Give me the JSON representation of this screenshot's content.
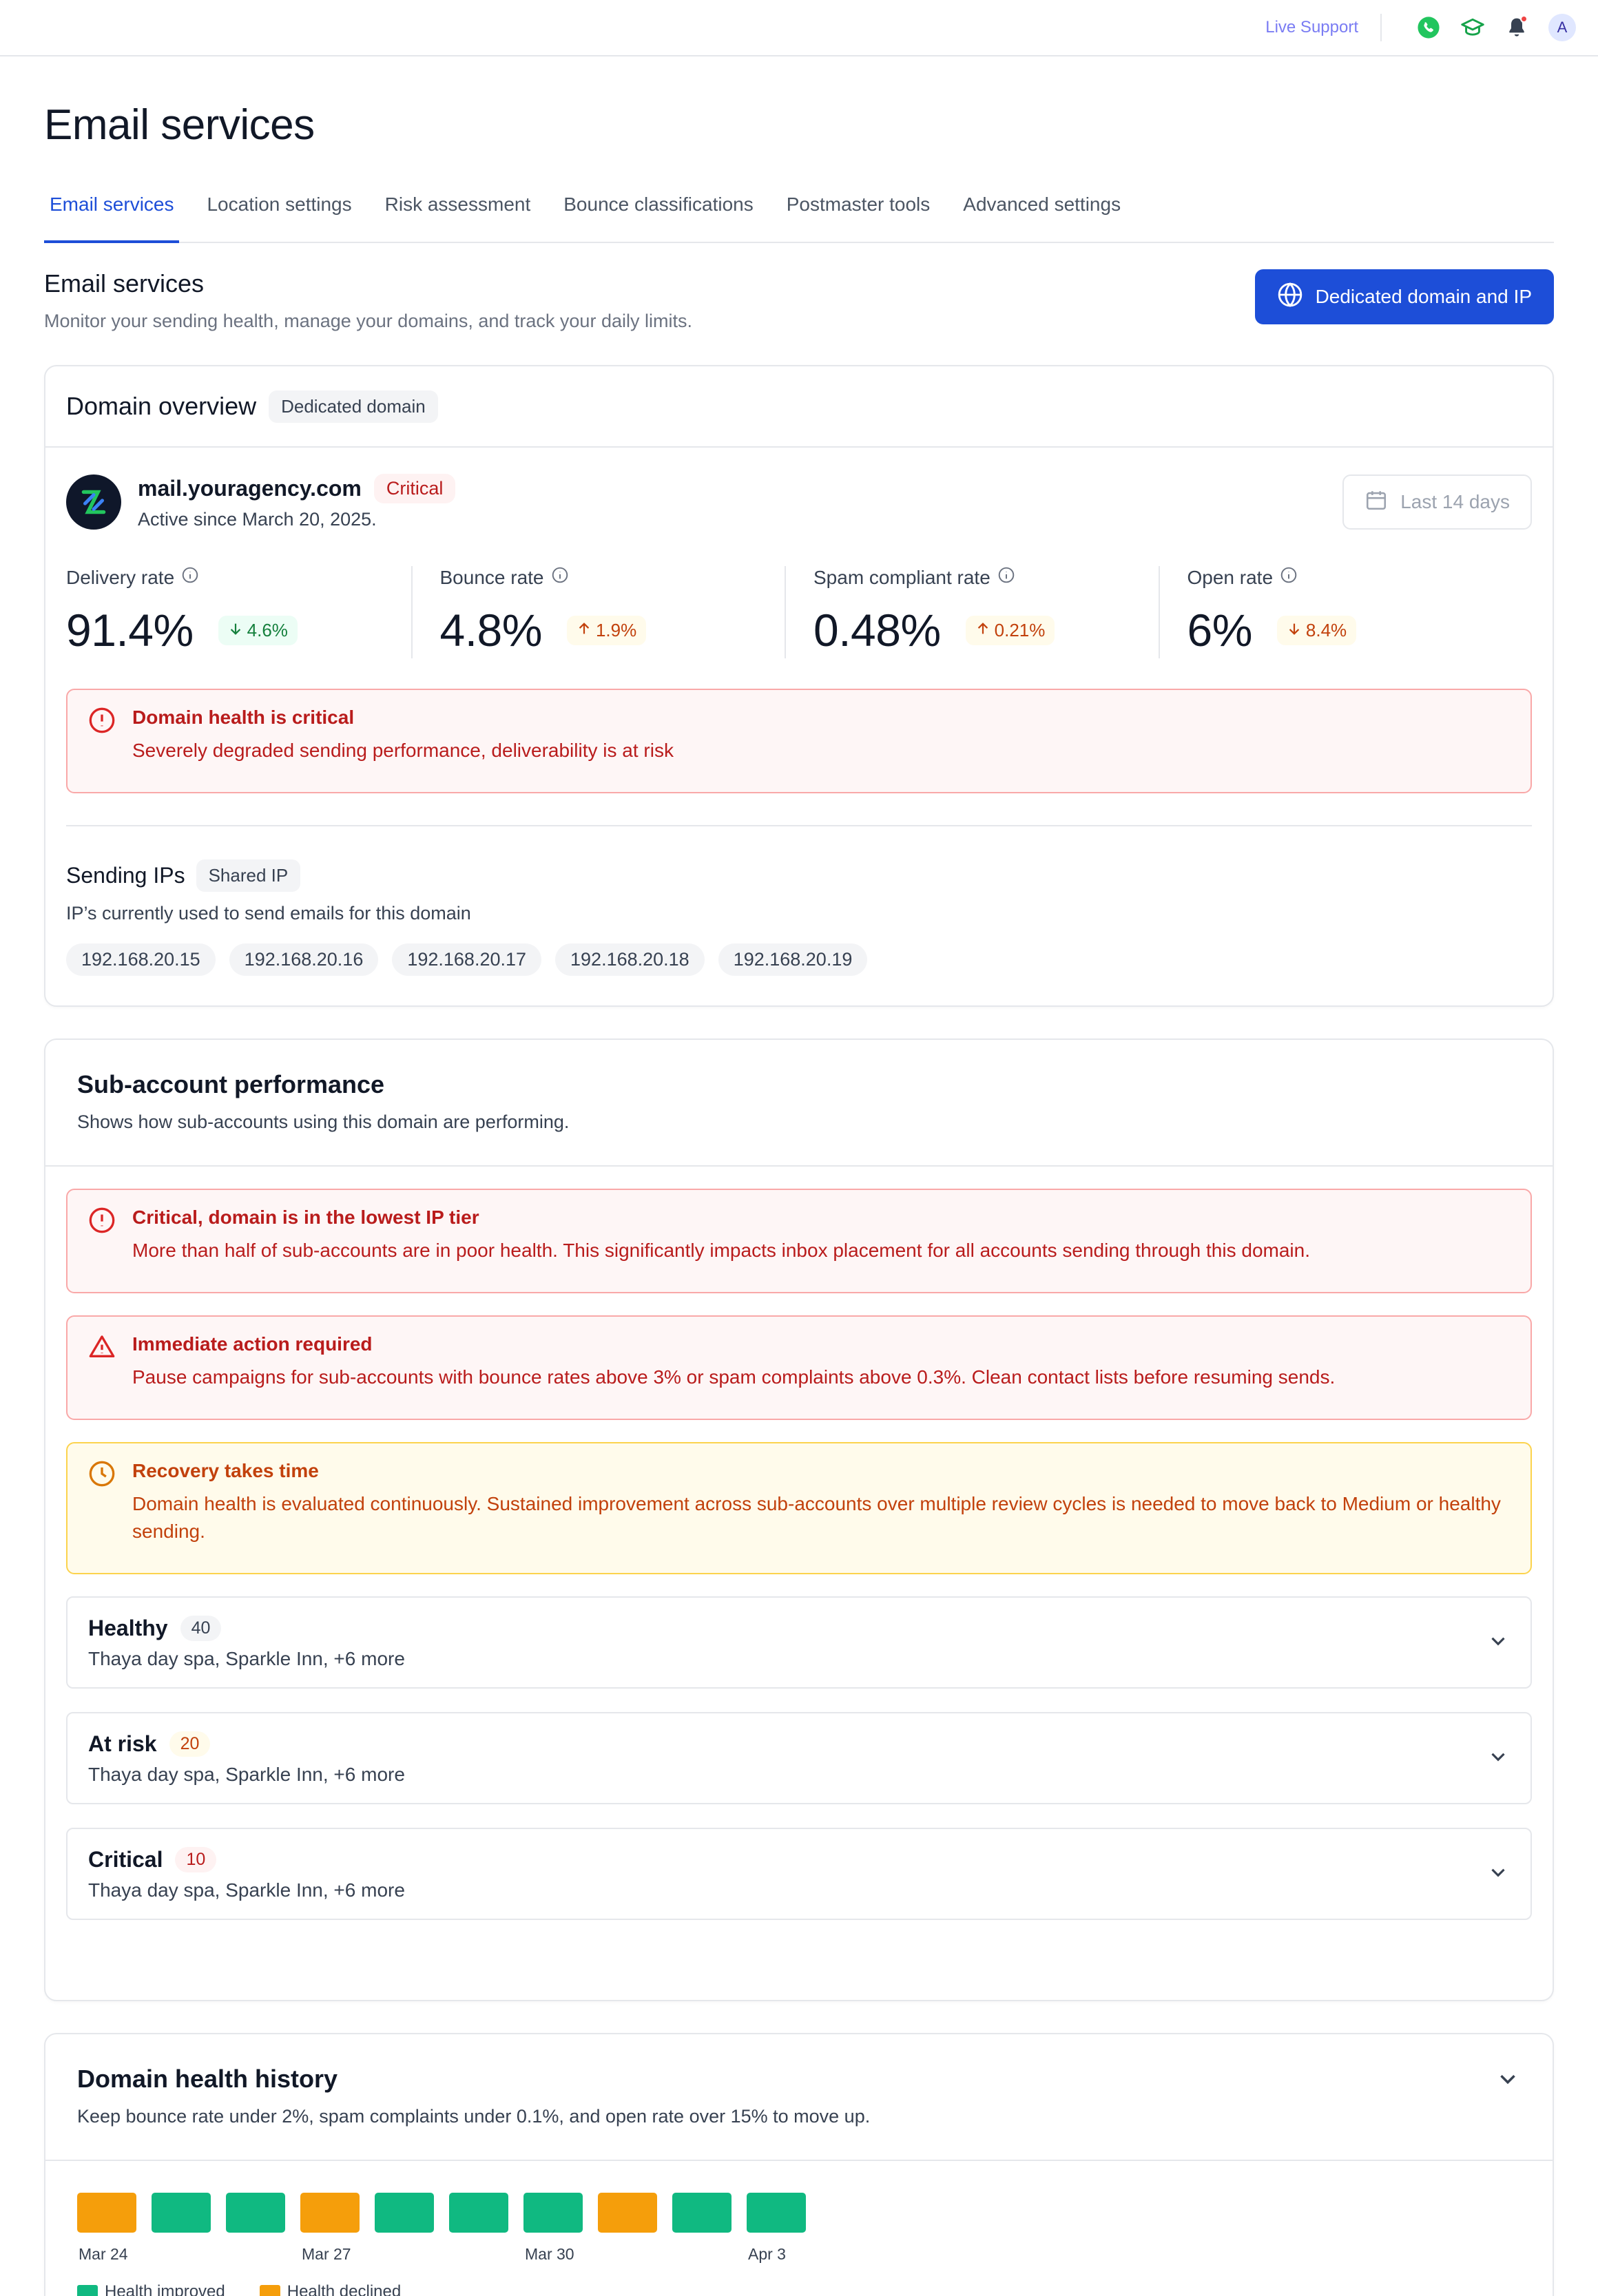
{
  "topbar": {
    "live_support": "Live Support",
    "avatar_initial": "A",
    "colors": {
      "phone": "#22c55e",
      "cap": "#16a34a",
      "bell": "#374151",
      "dot": "#ef4444"
    }
  },
  "page": {
    "title": "Email services",
    "tabs": [
      {
        "label": "Email services",
        "active": true
      },
      {
        "label": "Location settings",
        "active": false
      },
      {
        "label": "Risk assessment",
        "active": false
      },
      {
        "label": "Bounce classifications",
        "active": false
      },
      {
        "label": "Postmaster tools",
        "active": false
      },
      {
        "label": "Advanced settings",
        "active": false
      }
    ]
  },
  "section": {
    "title": "Email services",
    "description": "Monitor your sending health, manage your domains, and track your daily limits.",
    "primary_button": "Dedicated domain and IP"
  },
  "domain_overview": {
    "title": "Domain overview",
    "chip": "Dedicated domain",
    "domain": "mail.youragency.com",
    "status": "Critical",
    "active_since": "Active since March 20, 2025.",
    "date_range": "Last 14 days",
    "metrics": [
      {
        "label": "Delivery rate",
        "value": "91.4%",
        "delta": "4.6%",
        "direction": "down",
        "tone": "good"
      },
      {
        "label": "Bounce rate",
        "value": "4.8%",
        "delta": "1.9%",
        "direction": "up",
        "tone": "warn"
      },
      {
        "label": "Spam compliant rate",
        "value": "0.48%",
        "delta": "0.21%",
        "direction": "up",
        "tone": "warn"
      },
      {
        "label": "Open rate",
        "value": "6%",
        "delta": "8.4%",
        "direction": "down",
        "tone": "warn"
      }
    ],
    "alert": {
      "title": "Domain health is critical",
      "body": "Severely degraded sending performance, deliverability is at risk"
    },
    "sending_ips": {
      "title": "Sending IPs",
      "chip": "Shared IP",
      "description": "IP’s currently used to send emails for this domain",
      "ips": [
        "192.168.20.15",
        "192.168.20.16",
        "192.168.20.17",
        "192.168.20.18",
        "192.168.20.19"
      ]
    }
  },
  "sub_accounts": {
    "title": "Sub-account performance",
    "description": "Shows how sub-accounts using this domain are performing.",
    "alerts": [
      {
        "tone": "red",
        "icon": "alert-circle-icon",
        "title": "Critical, domain is in the lowest IP tier",
        "body": "More than half of sub-accounts are in poor health. This significantly impacts inbox placement for all accounts sending through this domain."
      },
      {
        "tone": "red",
        "icon": "warning-triangle-icon",
        "title": "Immediate action required",
        "body": "Pause campaigns for sub-accounts with bounce rates above 3% or spam complaints above 0.3%. Clean contact lists before resuming sends."
      },
      {
        "tone": "amber",
        "icon": "clock-icon",
        "title": "Recovery takes time",
        "body": "Domain health is evaluated continuously. Sustained improvement across sub-accounts over multiple review cycles is needed to move back to Medium or healthy sending."
      }
    ],
    "groups": [
      {
        "title": "Healthy",
        "count": "40",
        "tone": "gray",
        "subtitle": "Thaya day spa, Sparkle Inn, +6 more"
      },
      {
        "title": "At risk",
        "count": "20",
        "tone": "amber",
        "subtitle": "Thaya day spa, Sparkle Inn, +6 more"
      },
      {
        "title": "Critical",
        "count": "10",
        "tone": "red",
        "subtitle": "Thaya day spa, Sparkle Inn, +6 more"
      }
    ]
  },
  "history": {
    "title": "Domain health history",
    "description": "Keep bounce rate under 2%, spam complaints under 0.1%, and open rate over 15% to move up.",
    "days": [
      "declined",
      "improved",
      "improved",
      "declined",
      "improved",
      "improved",
      "improved",
      "declined",
      "improved",
      "improved"
    ],
    "labels": [
      {
        "index": 0,
        "text": "Mar 24"
      },
      {
        "index": 3,
        "text": "Mar 27"
      },
      {
        "index": 6,
        "text": "Mar 30"
      },
      {
        "index": 9,
        "text": "Apr 3"
      }
    ],
    "legend": {
      "improved": "Health improved",
      "declined": "Health declined"
    },
    "colors": {
      "improved": "#10b981",
      "declined": "#f59e0b"
    }
  }
}
